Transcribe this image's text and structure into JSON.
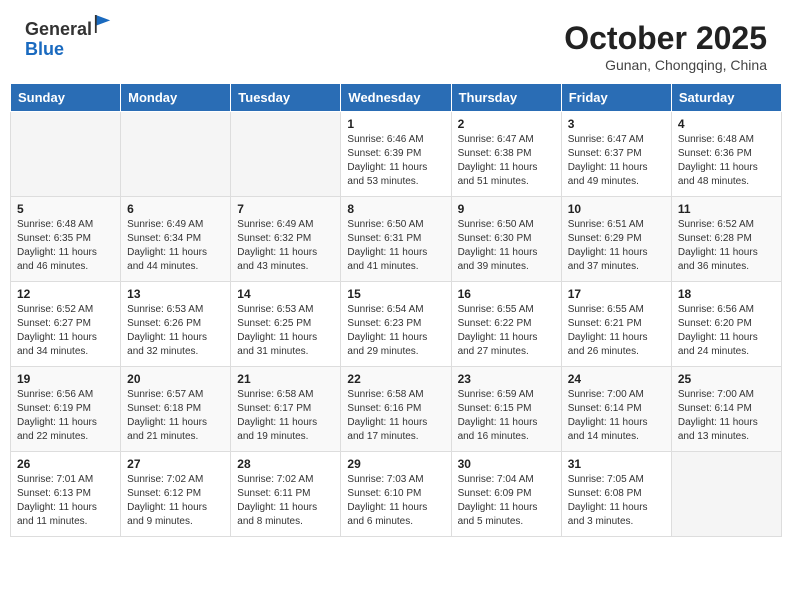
{
  "header": {
    "logo_line1": "General",
    "logo_line2": "Blue",
    "month_title": "October 2025",
    "subtitle": "Gunan, Chongqing, China"
  },
  "weekdays": [
    "Sunday",
    "Monday",
    "Tuesday",
    "Wednesday",
    "Thursday",
    "Friday",
    "Saturday"
  ],
  "weeks": [
    [
      {
        "day": "",
        "sunrise": "",
        "sunset": "",
        "daylight": "",
        "empty": true
      },
      {
        "day": "",
        "sunrise": "",
        "sunset": "",
        "daylight": "",
        "empty": true
      },
      {
        "day": "",
        "sunrise": "",
        "sunset": "",
        "daylight": "",
        "empty": true
      },
      {
        "day": "1",
        "sunrise": "Sunrise: 6:46 AM",
        "sunset": "Sunset: 6:39 PM",
        "daylight": "Daylight: 11 hours and 53 minutes."
      },
      {
        "day": "2",
        "sunrise": "Sunrise: 6:47 AM",
        "sunset": "Sunset: 6:38 PM",
        "daylight": "Daylight: 11 hours and 51 minutes."
      },
      {
        "day": "3",
        "sunrise": "Sunrise: 6:47 AM",
        "sunset": "Sunset: 6:37 PM",
        "daylight": "Daylight: 11 hours and 49 minutes."
      },
      {
        "day": "4",
        "sunrise": "Sunrise: 6:48 AM",
        "sunset": "Sunset: 6:36 PM",
        "daylight": "Daylight: 11 hours and 48 minutes."
      }
    ],
    [
      {
        "day": "5",
        "sunrise": "Sunrise: 6:48 AM",
        "sunset": "Sunset: 6:35 PM",
        "daylight": "Daylight: 11 hours and 46 minutes."
      },
      {
        "day": "6",
        "sunrise": "Sunrise: 6:49 AM",
        "sunset": "Sunset: 6:34 PM",
        "daylight": "Daylight: 11 hours and 44 minutes."
      },
      {
        "day": "7",
        "sunrise": "Sunrise: 6:49 AM",
        "sunset": "Sunset: 6:32 PM",
        "daylight": "Daylight: 11 hours and 43 minutes."
      },
      {
        "day": "8",
        "sunrise": "Sunrise: 6:50 AM",
        "sunset": "Sunset: 6:31 PM",
        "daylight": "Daylight: 11 hours and 41 minutes."
      },
      {
        "day": "9",
        "sunrise": "Sunrise: 6:50 AM",
        "sunset": "Sunset: 6:30 PM",
        "daylight": "Daylight: 11 hours and 39 minutes."
      },
      {
        "day": "10",
        "sunrise": "Sunrise: 6:51 AM",
        "sunset": "Sunset: 6:29 PM",
        "daylight": "Daylight: 11 hours and 37 minutes."
      },
      {
        "day": "11",
        "sunrise": "Sunrise: 6:52 AM",
        "sunset": "Sunset: 6:28 PM",
        "daylight": "Daylight: 11 hours and 36 minutes."
      }
    ],
    [
      {
        "day": "12",
        "sunrise": "Sunrise: 6:52 AM",
        "sunset": "Sunset: 6:27 PM",
        "daylight": "Daylight: 11 hours and 34 minutes."
      },
      {
        "day": "13",
        "sunrise": "Sunrise: 6:53 AM",
        "sunset": "Sunset: 6:26 PM",
        "daylight": "Daylight: 11 hours and 32 minutes."
      },
      {
        "day": "14",
        "sunrise": "Sunrise: 6:53 AM",
        "sunset": "Sunset: 6:25 PM",
        "daylight": "Daylight: 11 hours and 31 minutes."
      },
      {
        "day": "15",
        "sunrise": "Sunrise: 6:54 AM",
        "sunset": "Sunset: 6:23 PM",
        "daylight": "Daylight: 11 hours and 29 minutes."
      },
      {
        "day": "16",
        "sunrise": "Sunrise: 6:55 AM",
        "sunset": "Sunset: 6:22 PM",
        "daylight": "Daylight: 11 hours and 27 minutes."
      },
      {
        "day": "17",
        "sunrise": "Sunrise: 6:55 AM",
        "sunset": "Sunset: 6:21 PM",
        "daylight": "Daylight: 11 hours and 26 minutes."
      },
      {
        "day": "18",
        "sunrise": "Sunrise: 6:56 AM",
        "sunset": "Sunset: 6:20 PM",
        "daylight": "Daylight: 11 hours and 24 minutes."
      }
    ],
    [
      {
        "day": "19",
        "sunrise": "Sunrise: 6:56 AM",
        "sunset": "Sunset: 6:19 PM",
        "daylight": "Daylight: 11 hours and 22 minutes."
      },
      {
        "day": "20",
        "sunrise": "Sunrise: 6:57 AM",
        "sunset": "Sunset: 6:18 PM",
        "daylight": "Daylight: 11 hours and 21 minutes."
      },
      {
        "day": "21",
        "sunrise": "Sunrise: 6:58 AM",
        "sunset": "Sunset: 6:17 PM",
        "daylight": "Daylight: 11 hours and 19 minutes."
      },
      {
        "day": "22",
        "sunrise": "Sunrise: 6:58 AM",
        "sunset": "Sunset: 6:16 PM",
        "daylight": "Daylight: 11 hours and 17 minutes."
      },
      {
        "day": "23",
        "sunrise": "Sunrise: 6:59 AM",
        "sunset": "Sunset: 6:15 PM",
        "daylight": "Daylight: 11 hours and 16 minutes."
      },
      {
        "day": "24",
        "sunrise": "Sunrise: 7:00 AM",
        "sunset": "Sunset: 6:14 PM",
        "daylight": "Daylight: 11 hours and 14 minutes."
      },
      {
        "day": "25",
        "sunrise": "Sunrise: 7:00 AM",
        "sunset": "Sunset: 6:14 PM",
        "daylight": "Daylight: 11 hours and 13 minutes."
      }
    ],
    [
      {
        "day": "26",
        "sunrise": "Sunrise: 7:01 AM",
        "sunset": "Sunset: 6:13 PM",
        "daylight": "Daylight: 11 hours and 11 minutes."
      },
      {
        "day": "27",
        "sunrise": "Sunrise: 7:02 AM",
        "sunset": "Sunset: 6:12 PM",
        "daylight": "Daylight: 11 hours and 9 minutes."
      },
      {
        "day": "28",
        "sunrise": "Sunrise: 7:02 AM",
        "sunset": "Sunset: 6:11 PM",
        "daylight": "Daylight: 11 hours and 8 minutes."
      },
      {
        "day": "29",
        "sunrise": "Sunrise: 7:03 AM",
        "sunset": "Sunset: 6:10 PM",
        "daylight": "Daylight: 11 hours and 6 minutes."
      },
      {
        "day": "30",
        "sunrise": "Sunrise: 7:04 AM",
        "sunset": "Sunset: 6:09 PM",
        "daylight": "Daylight: 11 hours and 5 minutes."
      },
      {
        "day": "31",
        "sunrise": "Sunrise: 7:05 AM",
        "sunset": "Sunset: 6:08 PM",
        "daylight": "Daylight: 11 hours and 3 minutes."
      },
      {
        "day": "",
        "sunrise": "",
        "sunset": "",
        "daylight": "",
        "empty": true
      }
    ]
  ]
}
